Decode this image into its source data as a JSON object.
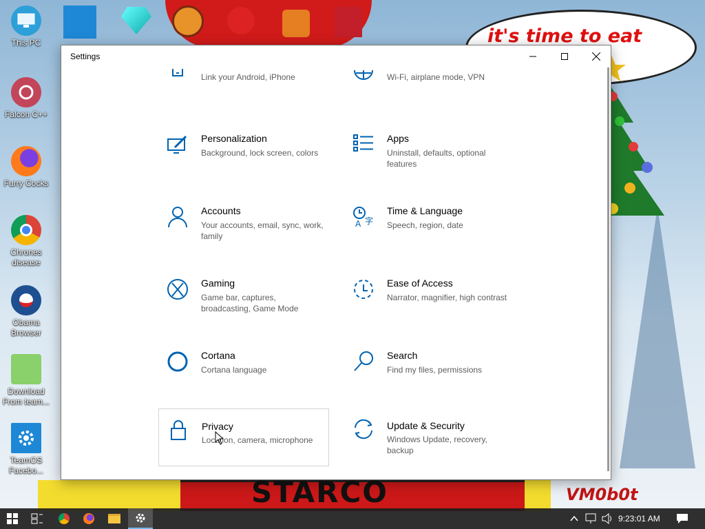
{
  "desktop": {
    "icons": [
      {
        "label": "This PC",
        "icon": "computer-icon"
      },
      {
        "label": "Falcon C++",
        "icon": "recycle-icon"
      },
      {
        "label": "Furry Cocks",
        "icon": "firefox-icon"
      },
      {
        "label": "Chrones disease",
        "icon": "chrome-icon"
      },
      {
        "label": "Obama Browser",
        "icon": "obama-logo-icon"
      },
      {
        "label": "Download From team...",
        "icon": "notepad-icon"
      },
      {
        "label": "TeamOS Facebo...",
        "icon": "gear-icon"
      }
    ],
    "bubble_text": "it's time to eat shit chew",
    "banner_text": "STARCO",
    "signature": "VM0b0t"
  },
  "window": {
    "title": "Settings",
    "tiles": [
      {
        "title": "",
        "desc": "Link your Android, iPhone",
        "icon": "phone-icon"
      },
      {
        "title": "",
        "desc": "Wi-Fi, airplane mode, VPN",
        "icon": "globe-icon"
      },
      {
        "title": "Personalization",
        "desc": "Background, lock screen, colors",
        "icon": "personalization-icon"
      },
      {
        "title": "Apps",
        "desc": "Uninstall, defaults, optional features",
        "icon": "apps-icon"
      },
      {
        "title": "Accounts",
        "desc": "Your accounts, email, sync, work, family",
        "icon": "person-icon"
      },
      {
        "title": "Time & Language",
        "desc": "Speech, region, date",
        "icon": "time-language-icon"
      },
      {
        "title": "Gaming",
        "desc": "Game bar, captures, broadcasting, Game Mode",
        "icon": "xbox-icon"
      },
      {
        "title": "Ease of Access",
        "desc": "Narrator, magnifier, high contrast",
        "icon": "ease-of-access-icon"
      },
      {
        "title": "Cortana",
        "desc": "Cortana language",
        "icon": "cortana-icon"
      },
      {
        "title": "Search",
        "desc": "Find my files, permissions",
        "icon": "search-icon"
      },
      {
        "title": "Privacy",
        "desc": "Location, camera, microphone",
        "icon": "lock-icon"
      },
      {
        "title": "Update & Security",
        "desc": "Windows Update, recovery, backup",
        "icon": "update-icon"
      }
    ]
  },
  "taskbar": {
    "clock": "9:23:01 AM",
    "apps": [
      "start-icon",
      "task-view-icon",
      "chrome-icon",
      "firefox-icon",
      "file-explorer-icon",
      "settings-icon"
    ]
  },
  "colors": {
    "accent": "#0063b1",
    "taskbar": "#1e1e1e"
  }
}
